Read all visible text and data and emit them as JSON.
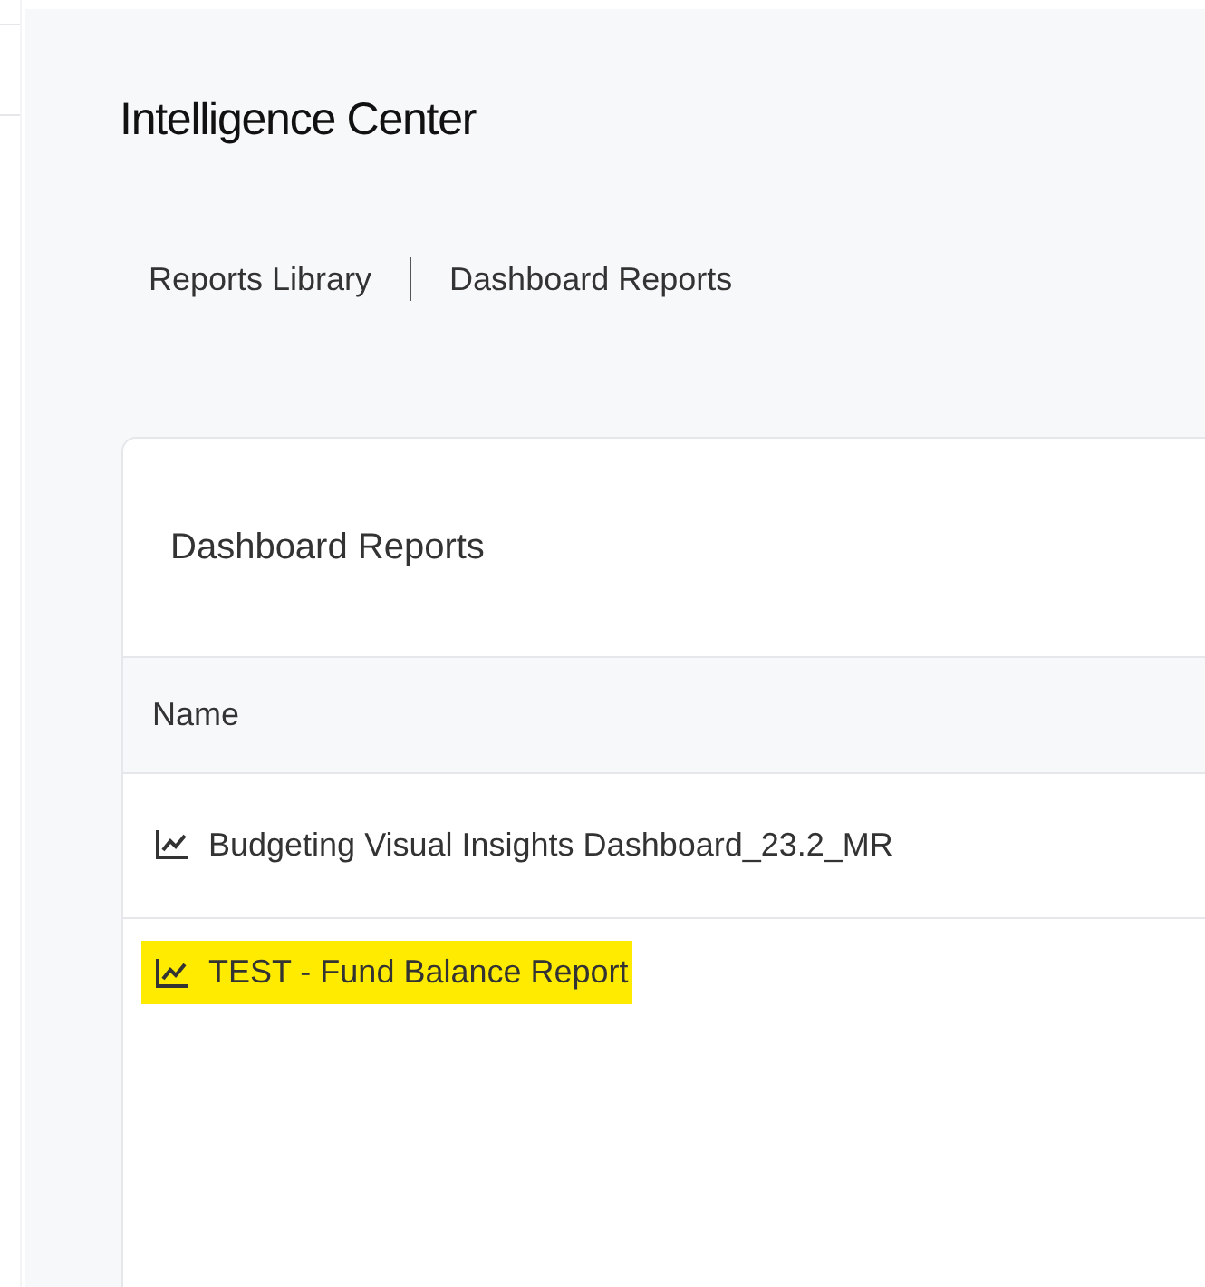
{
  "page": {
    "title": "Intelligence Center"
  },
  "breadcrumb": [
    {
      "label": "Reports Library"
    },
    {
      "label": "Dashboard Reports"
    }
  ],
  "card": {
    "title": "Dashboard Reports",
    "columns": [
      "Name"
    ],
    "rows": [
      {
        "name": "Budgeting Visual Insights Dashboard_23.2_MR",
        "highlighted": false
      },
      {
        "name": "TEST - Fund Balance Report",
        "highlighted": true
      }
    ]
  }
}
